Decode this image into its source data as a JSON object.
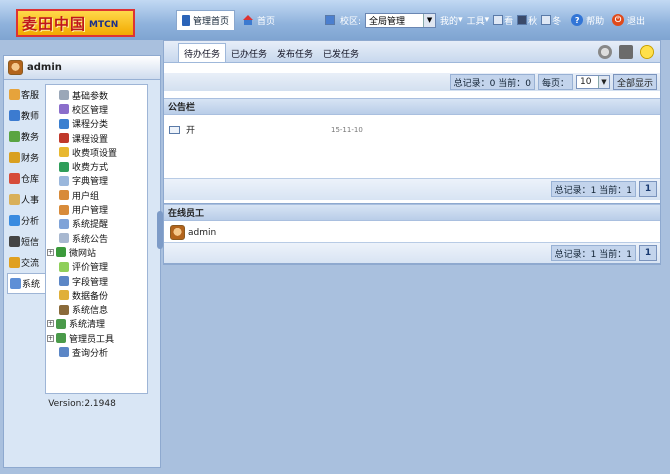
{
  "logo": {
    "cn": "麦田中国",
    "en": "MTCN"
  },
  "top_tabs": [
    {
      "label": "管理首页"
    },
    {
      "label": "首页"
    }
  ],
  "toolbar": {
    "campus_label": "校区:",
    "campus_value": "全局管理",
    "my_label": "我的",
    "tools_label": "工具",
    "view_labels": [
      "看",
      "秋",
      "冬"
    ],
    "help_label": "帮助",
    "exit_label": "退出"
  },
  "user": {
    "name": "admin"
  },
  "modules": [
    {
      "label": "客服",
      "icon": "customer-service-icon",
      "color": "#e6a33b"
    },
    {
      "label": "教师",
      "icon": "teacher-icon",
      "color": "#3c7bd0"
    },
    {
      "label": "教务",
      "icon": "academic-icon",
      "color": "#5aa442"
    },
    {
      "label": "财务",
      "icon": "finance-icon",
      "color": "#d9a021"
    },
    {
      "label": "仓库",
      "icon": "warehouse-icon",
      "color": "#d64c3a"
    },
    {
      "label": "人事",
      "icon": "hr-icon",
      "color": "#d9b05a"
    },
    {
      "label": "分析",
      "icon": "analysis-icon",
      "color": "#3a8be0"
    },
    {
      "label": "短信",
      "icon": "sms-icon",
      "color": "#444"
    },
    {
      "label": "交流",
      "icon": "chat-icon",
      "color": "#e0a020"
    },
    {
      "label": "系统",
      "icon": "system-icon",
      "color": "#5e8fd6"
    }
  ],
  "active_module": "系统",
  "submenu": [
    {
      "label": "基础参数",
      "icon": "gear-icon",
      "color": "#9aa7b8",
      "expand": false
    },
    {
      "label": "校区管理",
      "icon": "campus-icon",
      "color": "#8b6ecb",
      "expand": false
    },
    {
      "label": "课程分类",
      "icon": "course-category-icon",
      "color": "#3b7fd0",
      "expand": false
    },
    {
      "label": "课程设置",
      "icon": "course-setting-icon",
      "color": "#c0392b",
      "expand": false
    },
    {
      "label": "收费项设置",
      "icon": "fee-item-icon",
      "color": "#e8b830",
      "expand": false
    },
    {
      "label": "收费方式",
      "icon": "fee-method-icon",
      "color": "#2f9e5a",
      "expand": false
    },
    {
      "label": "字典管理",
      "icon": "dictionary-icon",
      "color": "#9ab7dc",
      "expand": false
    },
    {
      "label": "用户组",
      "icon": "user-group-icon",
      "color": "#d88b3a",
      "expand": false
    },
    {
      "label": "用户管理",
      "icon": "user-manage-icon",
      "color": "#d88b3a",
      "expand": false
    },
    {
      "label": "系统提醒",
      "icon": "reminder-icon",
      "color": "#7fa3d8",
      "expand": false
    },
    {
      "label": "系统公告",
      "icon": "notice-icon",
      "color": "#a8b8d0",
      "expand": false
    },
    {
      "label": "微网站",
      "icon": "micro-site-icon",
      "color": "#3b9a3b",
      "expand": true
    },
    {
      "label": "评价管理",
      "icon": "evaluation-icon",
      "color": "#8fcf5a",
      "expand": false
    },
    {
      "label": "字段管理",
      "icon": "field-icon",
      "color": "#5b86c6",
      "expand": false
    },
    {
      "label": "数据备份",
      "icon": "backup-icon",
      "color": "#e0b03a",
      "expand": false
    },
    {
      "label": "系统信息",
      "icon": "sysinfo-icon",
      "color": "#8a6a3a",
      "expand": false
    },
    {
      "label": "系统清理",
      "icon": "cleanup-icon",
      "color": "#4a9a4a",
      "expand": true
    },
    {
      "label": "管理员工具",
      "icon": "admin-tool-icon",
      "color": "#4a9a4a",
      "expand": true
    },
    {
      "label": "查询分析",
      "icon": "query-icon",
      "color": "#5b86c6",
      "expand": false
    }
  ],
  "version": "Version:2.1948",
  "main_tabs": [
    {
      "label": "待办任务"
    },
    {
      "label": "已办任务"
    },
    {
      "label": "发布任务"
    },
    {
      "label": "已发任务"
    }
  ],
  "pager1": {
    "summary": "总记录：0 当前：0",
    "per_page_label": "每页：",
    "per_page_value": "10",
    "show_all": "全部显示"
  },
  "notice": {
    "title": "公告栏",
    "item_text": "开",
    "item_date": "15-11-10",
    "summary": "总记录：1 当前：1",
    "page": "1"
  },
  "online": {
    "title": "在线员工",
    "user": "admin",
    "summary": "总记录：1 当前：1",
    "page": "1"
  }
}
